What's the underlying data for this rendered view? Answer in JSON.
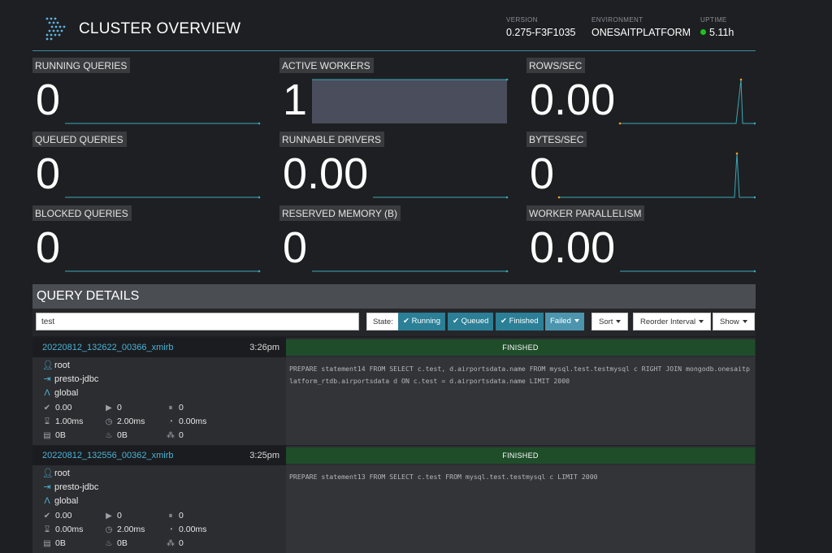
{
  "header": {
    "title": "CLUSTER OVERVIEW",
    "version_label": "VERSION",
    "version": "0.275-F3F1035",
    "environment_label": "ENVIRONMENT",
    "environment": "ONESAITPLATFORM",
    "uptime_label": "UPTIME",
    "uptime": "5.11h",
    "status_color": "#1fc11f"
  },
  "metrics": [
    {
      "label": "RUNNING QUERIES",
      "value": "0"
    },
    {
      "label": "ACTIVE WORKERS",
      "value": "1"
    },
    {
      "label": "ROWS/SEC",
      "value": "0.00"
    },
    {
      "label": "QUEUED QUERIES",
      "value": "0"
    },
    {
      "label": "RUNNABLE DRIVERS",
      "value": "0.00"
    },
    {
      "label": "BYTES/SEC",
      "value": "0"
    },
    {
      "label": "BLOCKED QUERIES",
      "value": "0"
    },
    {
      "label": "RESERVED MEMORY (B)",
      "value": "0"
    },
    {
      "label": "WORKER PARALLELISM",
      "value": "0.00"
    }
  ],
  "query_details": {
    "title": "QUERY DETAILS",
    "search_value": "test",
    "state_label": "State:",
    "filters": [
      {
        "label": "Running",
        "checked": true
      },
      {
        "label": "Queued",
        "checked": true
      },
      {
        "label": "Finished",
        "checked": true
      },
      {
        "label": "Failed",
        "checked": false
      }
    ],
    "sort_label": "Sort",
    "reorder_label": "Reorder Interval",
    "show_label": "Show"
  },
  "queries": [
    {
      "id": "20220812_132622_00366_xmirb",
      "time": "3:26pm",
      "state": "FINISHED",
      "user": "root",
      "source": "presto-jdbc",
      "resource_group": "global",
      "completed_splits": "0.00",
      "running_splits": "0",
      "queued_splits": "0",
      "wall_time": "1.00ms",
      "cpu_time": "2.00ms",
      "elapsed_time": "0.00ms",
      "memory": "0B",
      "peak_memory": "0B",
      "drivers": "0",
      "sql": "PREPARE statement14 FROM SELECT c.test, d.airportsdata.name FROM mysql.test.testmysql c RIGHT JOIN mongodb.onesaitplatform_rtdb.airportsdata d ON c.test = d.airportsdata.name LIMIT 2000"
    },
    {
      "id": "20220812_132556_00362_xmirb",
      "time": "3:25pm",
      "state": "FINISHED",
      "user": "root",
      "source": "presto-jdbc",
      "resource_group": "global",
      "completed_splits": "0.00",
      "running_splits": "0",
      "queued_splits": "0",
      "wall_time": "0.00ms",
      "cpu_time": "2.00ms",
      "elapsed_time": "0.00ms",
      "memory": "0B",
      "peak_memory": "0B",
      "drivers": "0",
      "sql": "PREPARE statement13 FROM SELECT c.test FROM mysql.test.testmysql c LIMIT 2000"
    }
  ],
  "colors": {
    "accent": "#2b7f96",
    "link": "#4ab3d6",
    "finished": "#1f4d2a",
    "sparkline": "#3aa9b8",
    "peak": "#f0a020"
  }
}
